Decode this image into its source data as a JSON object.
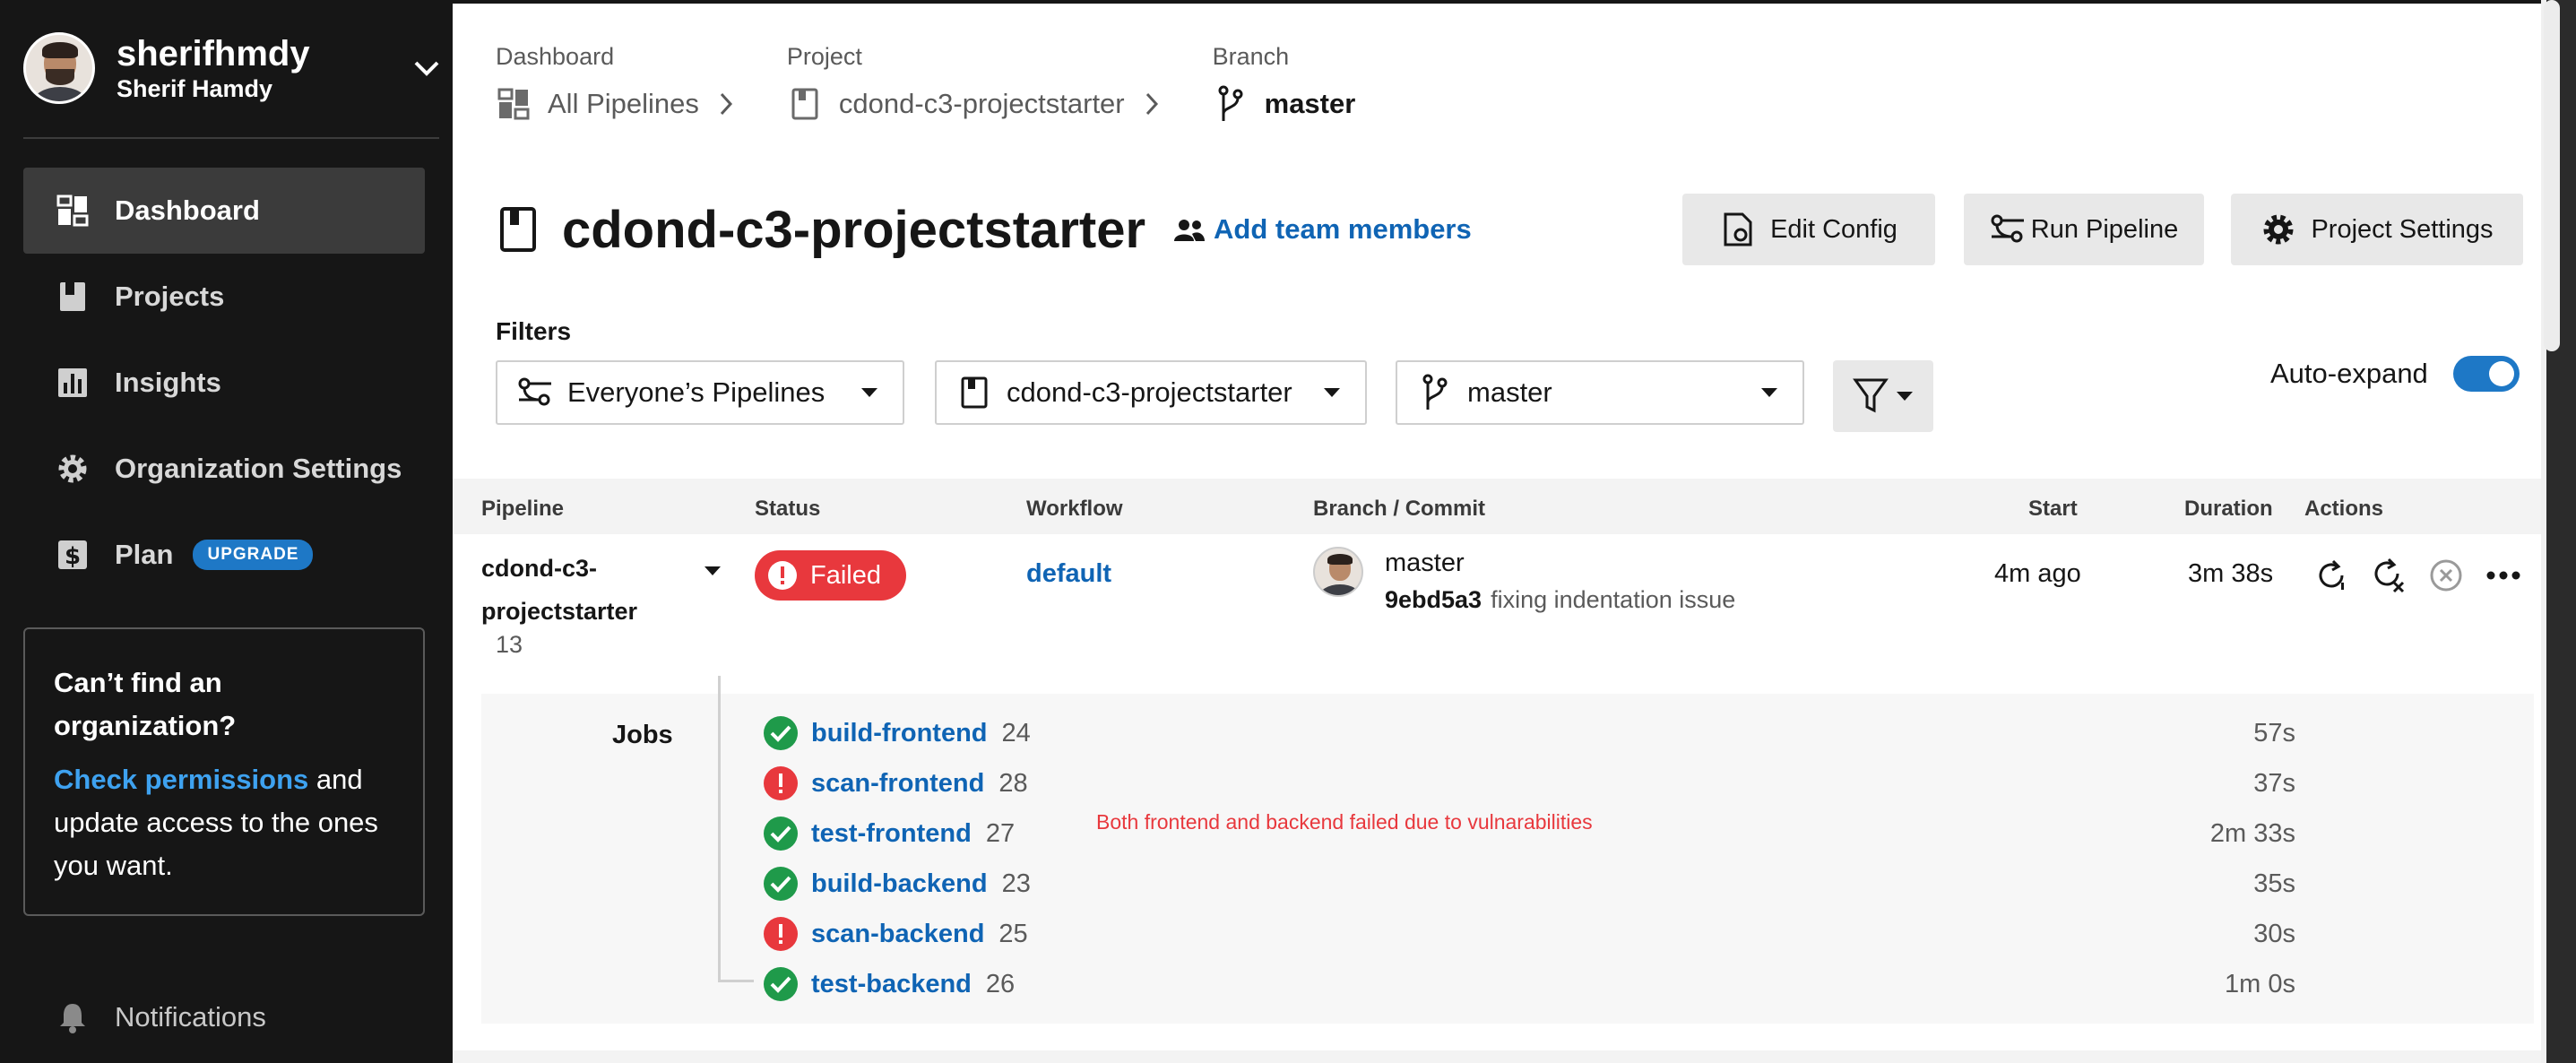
{
  "user": {
    "handle": "sherifhmdy",
    "name": "Sherif Hamdy"
  },
  "sidebar": {
    "items": [
      {
        "label": "Dashboard",
        "icon": "dashboard-icon",
        "active": true
      },
      {
        "label": "Projects",
        "icon": "book-icon"
      },
      {
        "label": "Insights",
        "icon": "bar-chart-icon"
      },
      {
        "label": "Organization Settings",
        "icon": "gear-icon"
      },
      {
        "label": "Plan",
        "icon": "dollar-icon",
        "badge": "UPGRADE"
      }
    ],
    "org_box": {
      "title": "Can’t find an organization?",
      "link": "Check permissions",
      "rest": " and update access to the ones you want."
    },
    "notifications": "Notifications"
  },
  "breadcrumbs": {
    "dashboard_label": "Dashboard",
    "dashboard_value": "All Pipelines",
    "project_label": "Project",
    "project_value": "cdond-c3-projectstarter",
    "branch_label": "Branch",
    "branch_value": "master"
  },
  "header": {
    "title": "cdond-c3-projectstarter",
    "add_team": "Add team members",
    "edit_config": "Edit Config",
    "run_pipeline": "Run Pipeline",
    "project_settings": "Project Settings"
  },
  "filters": {
    "label": "Filters",
    "pipelines": "Everyone’s Pipelines",
    "project": "cdond-c3-projectstarter",
    "branch": "master",
    "auto_expand": "Auto-expand",
    "auto_expand_on": true
  },
  "table": {
    "headers": {
      "pipeline": "Pipeline",
      "status": "Status",
      "workflow": "Workflow",
      "branch_commit": "Branch / Commit",
      "start": "Start",
      "duration": "Duration",
      "actions": "Actions"
    },
    "row": {
      "pipeline": "cdond-c3-projectstarter",
      "number": "13",
      "status": "Failed",
      "workflow": "default",
      "branch": "master",
      "sha": "9ebd5a3",
      "message": "fixing indentation issue",
      "start": "4m ago",
      "duration": "3m 38s"
    },
    "jobs_label": "Jobs",
    "jobs": [
      {
        "name": "build-frontend",
        "num": "24",
        "status": "success",
        "duration": "57s"
      },
      {
        "name": "scan-frontend",
        "num": "28",
        "status": "failed",
        "duration": "37s"
      },
      {
        "name": "test-frontend",
        "num": "27",
        "status": "success",
        "duration": "2m 33s"
      },
      {
        "name": "build-backend",
        "num": "23",
        "status": "success",
        "duration": "35s"
      },
      {
        "name": "scan-backend",
        "num": "25",
        "status": "failed",
        "duration": "30s"
      },
      {
        "name": "test-backend",
        "num": "26",
        "status": "success",
        "duration": "1m 0s"
      }
    ],
    "annotation": "Both frontend and backend failed due to vulnarabilities"
  },
  "colors": {
    "sidebar_bg": "#161616",
    "link": "#0f64b4",
    "failed": "#e8383d",
    "success": "#1f9a4a",
    "accent": "#1e78c6"
  }
}
